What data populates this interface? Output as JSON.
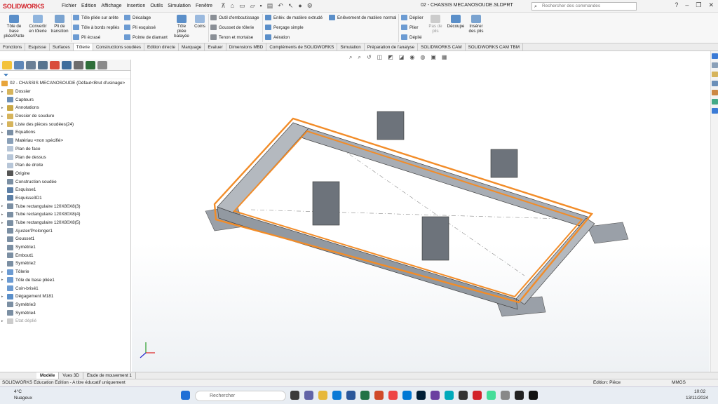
{
  "app": {
    "logo": "SOLIDWORKS",
    "doc_title": "02 - CHASSIS MECANOSOUDE.SLDPRT",
    "search_placeholder": "Rechercher des commandes"
  },
  "menu": [
    "Fichier",
    "Edition",
    "Affichage",
    "Insertion",
    "Outils",
    "Simulation",
    "Fenêtre"
  ],
  "ribbon": {
    "tole_base": "Tôle de base pliée/Patte",
    "convertir": "Convertir en tôlerie",
    "pli_transition": "Pli de transition",
    "tole_pliee_arete": "Tôle pliée sur arête",
    "tole_bords": "Tôle à bords repliés",
    "pli_ecrase": "Pli écrasé",
    "decalage": "Décalage",
    "pli_esquisse": "Pli esquissé",
    "pointe_diamant": "Pointe de diamant",
    "tole_pliee_balayee": "Tôle pliée balayée",
    "coins": "Coins",
    "outil_emboutissage": "Outil d'emboutissage",
    "gousset_tolerie": "Gousset de tôlerie",
    "tenon_mortaise": "Tenon et mortaise",
    "enlev_extrude": "Enlév. de matière extrudé",
    "percage_simple": "Perçage simple",
    "aeration": "Aération",
    "enlev_normal": "Enlèvement de matière normal",
    "deplier": "Déplier",
    "plier": "Plier",
    "deplie": "Déplié",
    "pas_plis": "Pas de plis",
    "decoupe": "Découpe",
    "inserer_plis": "Insérer des plis"
  },
  "tabs": [
    "Fonctions",
    "Esquisse",
    "Surfaces",
    "Tôlerie",
    "Constructions soudées",
    "Edition directe",
    "Marquage",
    "Evaluer",
    "Dimensions MBD",
    "Compléments de SOLIDWORKS",
    "Simulation",
    "Préparation de l'analyse",
    "SOLIDWORKS CAM",
    "SOLIDWORKS CAM TBM"
  ],
  "active_tab": "Tôlerie",
  "tree": {
    "root": "02 - CHASSIS MECANOSOUDE (Défaut<Brut d'usinage>",
    "items": [
      "Dossier",
      "Capteurs",
      "Annotations",
      "Dossier de soudure",
      "Liste des pièces soudées(24)",
      "Equations",
      "Matériau <non spécifié>",
      "Plan de face",
      "Plan de dessus",
      "Plan de droite",
      "Origine",
      "Construction soudée",
      "Esquisse1",
      "Esquisse3D1",
      "Tube rectangulaire 120X80X8(3)",
      "Tube rectangulaire 120X80X8(4)",
      "Tube rectangulaire 120X80X8(5)",
      "Ajuster/Prolonger1",
      "Gousset1",
      "Symétrie1",
      "Embout1",
      "Symétrie2",
      "Tôlerie",
      "Tôle de base pliée1",
      "Coin-brisé1",
      "Dégagement M181",
      "Symétrie3",
      "Symétrie4",
      "Etat déplié"
    ]
  },
  "bottom_tabs": [
    "Modèle",
    "Vues 3D",
    "Etude de mouvement 1"
  ],
  "status": {
    "left": "SOLIDWORKS Education Edition - A titre éducatif uniquement",
    "mode": "Edition: Pièce",
    "units": "MMGS"
  },
  "taskbar": {
    "weather_temp": "4°C",
    "weather_text": "Nuageux",
    "search": "Rechercher",
    "time": "10:02",
    "date": "13/11/2024"
  },
  "colors": {
    "accent": "#f28c28",
    "steel": "#8a8f96"
  }
}
